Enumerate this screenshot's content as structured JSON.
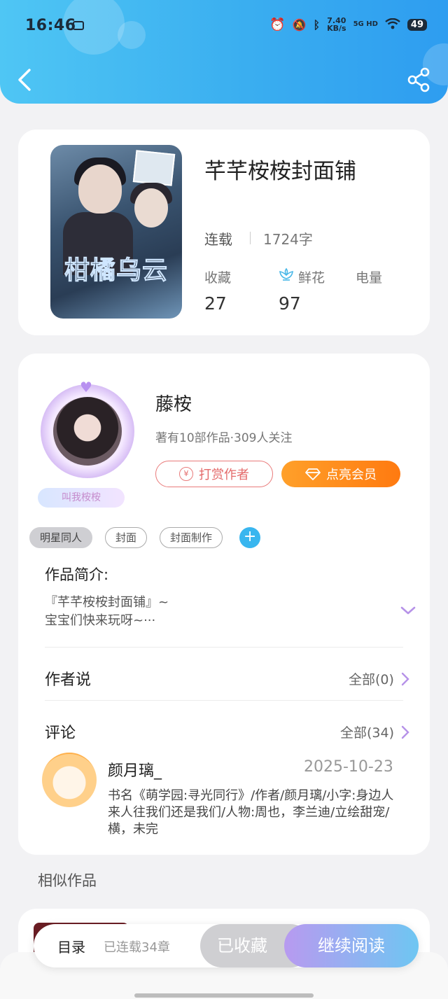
{
  "status_bar": {
    "time": "16:46",
    "net_speed_value": "7.40",
    "net_speed_unit": "KB/s",
    "network": "5G HD",
    "battery": "49"
  },
  "book": {
    "title": "芊芊桉桉封面铺",
    "status": "连载",
    "word_count": "1724字",
    "cover_text": "柑橘乌云",
    "stats": {
      "favorites_label": "收藏",
      "favorites_value": "27",
      "flowers_label": "鲜花",
      "flowers_value": "97",
      "power_label": "电量"
    }
  },
  "author": {
    "name": "藤桉",
    "meta": "著有10部作品·309人关注",
    "nick_tag": "叫我桉桉",
    "tip_button": "打赏作者",
    "tip_icon": "¥",
    "vip_button": "点亮会员"
  },
  "tags": [
    "明星同人",
    "封面",
    "封面制作"
  ],
  "intro": {
    "heading": "作品简介:",
    "line1": "『芊芊桉桉封面铺』~",
    "line2": "宝宝们快来玩呀~···"
  },
  "author_says": {
    "heading": "作者说",
    "all": "全部(0)"
  },
  "comments": {
    "heading": "评论",
    "all": "全部(34)",
    "items": [
      {
        "name": "颜月璃_",
        "date": "2025-10-23",
        "text": "书名《萌学园:寻光同行》/作者/颜月璃/小字:身边人来人往我们还是我们/人物:周也，李兰迪/立绘甜宠/横，未完"
      }
    ]
  },
  "similar": {
    "heading": "相似作品"
  },
  "bottom_bar": {
    "toc": "目录",
    "chapters": "已连载34章",
    "favorited": "已收藏",
    "continue": "继续阅读"
  },
  "colors": {
    "header_blue": "#3aaef0",
    "vip_orange": "#ff8a1a",
    "tip_red": "#e46b6b",
    "accent_blue": "#39b6ef"
  }
}
